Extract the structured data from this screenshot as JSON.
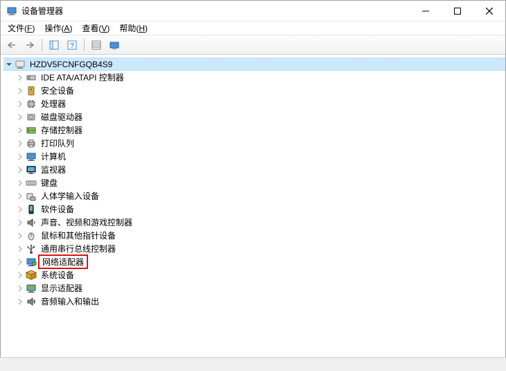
{
  "title": "设备管理器",
  "menus": [
    {
      "label": "文件(F)",
      "key": "F"
    },
    {
      "label": "操作(A)",
      "key": "A"
    },
    {
      "label": "查看(V)",
      "key": "V"
    },
    {
      "label": "帮助(H)",
      "key": "H"
    }
  ],
  "computer_name": "HZDV5FCNFGQB4S9",
  "categories": [
    {
      "icon": "ide",
      "label": "IDE ATA/ATAPI 控制器"
    },
    {
      "icon": "security",
      "label": "安全设备"
    },
    {
      "icon": "processor",
      "label": "处理器"
    },
    {
      "icon": "disk",
      "label": "磁盘驱动器"
    },
    {
      "icon": "storage",
      "label": "存储控制器"
    },
    {
      "icon": "printer",
      "label": "打印队列"
    },
    {
      "icon": "computer",
      "label": "计算机"
    },
    {
      "icon": "monitor",
      "label": "监视器"
    },
    {
      "icon": "keyboard",
      "label": "键盘"
    },
    {
      "icon": "hid",
      "label": "人体学输入设备"
    },
    {
      "icon": "software",
      "label": "软件设备"
    },
    {
      "icon": "sound",
      "label": "声音、视频和游戏控制器"
    },
    {
      "icon": "mouse",
      "label": "鼠标和其他指针设备"
    },
    {
      "icon": "usb",
      "label": "通用串行总线控制器"
    },
    {
      "icon": "network",
      "label": "网络适配器",
      "highlighted": true
    },
    {
      "icon": "system",
      "label": "系统设备"
    },
    {
      "icon": "display",
      "label": "显示适配器"
    },
    {
      "icon": "audio",
      "label": "音频输入和输出"
    }
  ]
}
